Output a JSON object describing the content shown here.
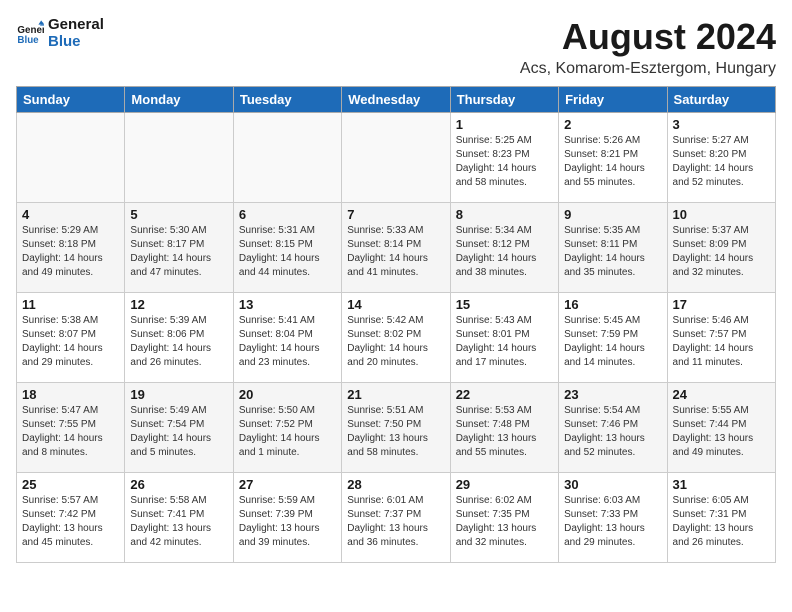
{
  "header": {
    "logo_line1": "General",
    "logo_line2": "Blue",
    "main_title": "August 2024",
    "subtitle": "Acs, Komarom-Esztergom, Hungary"
  },
  "days_of_week": [
    "Sunday",
    "Monday",
    "Tuesday",
    "Wednesday",
    "Thursday",
    "Friday",
    "Saturday"
  ],
  "weeks": [
    [
      {
        "day": "",
        "info": ""
      },
      {
        "day": "",
        "info": ""
      },
      {
        "day": "",
        "info": ""
      },
      {
        "day": "",
        "info": ""
      },
      {
        "day": "1",
        "info": "Sunrise: 5:25 AM\nSunset: 8:23 PM\nDaylight: 14 hours\nand 58 minutes."
      },
      {
        "day": "2",
        "info": "Sunrise: 5:26 AM\nSunset: 8:21 PM\nDaylight: 14 hours\nand 55 minutes."
      },
      {
        "day": "3",
        "info": "Sunrise: 5:27 AM\nSunset: 8:20 PM\nDaylight: 14 hours\nand 52 minutes."
      }
    ],
    [
      {
        "day": "4",
        "info": "Sunrise: 5:29 AM\nSunset: 8:18 PM\nDaylight: 14 hours\nand 49 minutes."
      },
      {
        "day": "5",
        "info": "Sunrise: 5:30 AM\nSunset: 8:17 PM\nDaylight: 14 hours\nand 47 minutes."
      },
      {
        "day": "6",
        "info": "Sunrise: 5:31 AM\nSunset: 8:15 PM\nDaylight: 14 hours\nand 44 minutes."
      },
      {
        "day": "7",
        "info": "Sunrise: 5:33 AM\nSunset: 8:14 PM\nDaylight: 14 hours\nand 41 minutes."
      },
      {
        "day": "8",
        "info": "Sunrise: 5:34 AM\nSunset: 8:12 PM\nDaylight: 14 hours\nand 38 minutes."
      },
      {
        "day": "9",
        "info": "Sunrise: 5:35 AM\nSunset: 8:11 PM\nDaylight: 14 hours\nand 35 minutes."
      },
      {
        "day": "10",
        "info": "Sunrise: 5:37 AM\nSunset: 8:09 PM\nDaylight: 14 hours\nand 32 minutes."
      }
    ],
    [
      {
        "day": "11",
        "info": "Sunrise: 5:38 AM\nSunset: 8:07 PM\nDaylight: 14 hours\nand 29 minutes."
      },
      {
        "day": "12",
        "info": "Sunrise: 5:39 AM\nSunset: 8:06 PM\nDaylight: 14 hours\nand 26 minutes."
      },
      {
        "day": "13",
        "info": "Sunrise: 5:41 AM\nSunset: 8:04 PM\nDaylight: 14 hours\nand 23 minutes."
      },
      {
        "day": "14",
        "info": "Sunrise: 5:42 AM\nSunset: 8:02 PM\nDaylight: 14 hours\nand 20 minutes."
      },
      {
        "day": "15",
        "info": "Sunrise: 5:43 AM\nSunset: 8:01 PM\nDaylight: 14 hours\nand 17 minutes."
      },
      {
        "day": "16",
        "info": "Sunrise: 5:45 AM\nSunset: 7:59 PM\nDaylight: 14 hours\nand 14 minutes."
      },
      {
        "day": "17",
        "info": "Sunrise: 5:46 AM\nSunset: 7:57 PM\nDaylight: 14 hours\nand 11 minutes."
      }
    ],
    [
      {
        "day": "18",
        "info": "Sunrise: 5:47 AM\nSunset: 7:55 PM\nDaylight: 14 hours\nand 8 minutes."
      },
      {
        "day": "19",
        "info": "Sunrise: 5:49 AM\nSunset: 7:54 PM\nDaylight: 14 hours\nand 5 minutes."
      },
      {
        "day": "20",
        "info": "Sunrise: 5:50 AM\nSunset: 7:52 PM\nDaylight: 14 hours\nand 1 minute."
      },
      {
        "day": "21",
        "info": "Sunrise: 5:51 AM\nSunset: 7:50 PM\nDaylight: 13 hours\nand 58 minutes."
      },
      {
        "day": "22",
        "info": "Sunrise: 5:53 AM\nSunset: 7:48 PM\nDaylight: 13 hours\nand 55 minutes."
      },
      {
        "day": "23",
        "info": "Sunrise: 5:54 AM\nSunset: 7:46 PM\nDaylight: 13 hours\nand 52 minutes."
      },
      {
        "day": "24",
        "info": "Sunrise: 5:55 AM\nSunset: 7:44 PM\nDaylight: 13 hours\nand 49 minutes."
      }
    ],
    [
      {
        "day": "25",
        "info": "Sunrise: 5:57 AM\nSunset: 7:42 PM\nDaylight: 13 hours\nand 45 minutes."
      },
      {
        "day": "26",
        "info": "Sunrise: 5:58 AM\nSunset: 7:41 PM\nDaylight: 13 hours\nand 42 minutes."
      },
      {
        "day": "27",
        "info": "Sunrise: 5:59 AM\nSunset: 7:39 PM\nDaylight: 13 hours\nand 39 minutes."
      },
      {
        "day": "28",
        "info": "Sunrise: 6:01 AM\nSunset: 7:37 PM\nDaylight: 13 hours\nand 36 minutes."
      },
      {
        "day": "29",
        "info": "Sunrise: 6:02 AM\nSunset: 7:35 PM\nDaylight: 13 hours\nand 32 minutes."
      },
      {
        "day": "30",
        "info": "Sunrise: 6:03 AM\nSunset: 7:33 PM\nDaylight: 13 hours\nand 29 minutes."
      },
      {
        "day": "31",
        "info": "Sunrise: 6:05 AM\nSunset: 7:31 PM\nDaylight: 13 hours\nand 26 minutes."
      }
    ]
  ]
}
